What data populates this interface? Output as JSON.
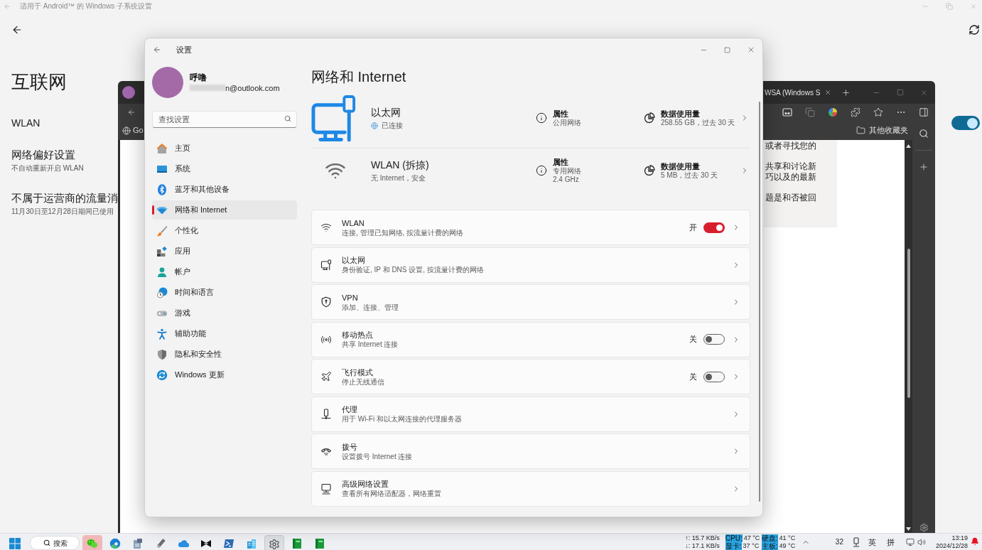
{
  "background_window": {
    "title": "适用于 Android™ 的 Windows 子系统设置",
    "heading": "互联网",
    "items": [
      {
        "kind": "toggle",
        "title": "WLAN",
        "on": true
      },
      {
        "kind": "text",
        "title": "网络偏好设置",
        "subtitle": "不自动重新开启 WLAN"
      },
      {
        "kind": "text",
        "title": "不属于运营商的流量消",
        "subtitle": "11月30日至12月28日期间已使用"
      }
    ]
  },
  "browser": {
    "tab_title": "WSA (Windows S",
    "favorites": [
      {
        "label": "Go"
      }
    ],
    "other_favorites": "其他收藏夹",
    "page_paragraphs": [
      [
        "或者寻找您的"
      ],
      [
        "共享和讨论新",
        "巧以及的最新"
      ],
      [
        "题是和否被回"
      ]
    ]
  },
  "settings": {
    "title": "设置",
    "account": {
      "name": "呼噜",
      "email": "n@outlook.com"
    },
    "search": {
      "placeholder": "查找设置"
    },
    "nav": [
      {
        "kind": "home",
        "label": "主页",
        "selected": false
      },
      {
        "kind": "system",
        "label": "系统",
        "selected": false
      },
      {
        "kind": "bluetooth",
        "label": "蓝牙和其他设备",
        "selected": false
      },
      {
        "kind": "network",
        "label": "网络和 Internet",
        "selected": true
      },
      {
        "kind": "personalization",
        "label": "个性化",
        "selected": false
      },
      {
        "kind": "apps",
        "label": "应用",
        "selected": false
      },
      {
        "kind": "accounts",
        "label": "帐户",
        "selected": false
      },
      {
        "kind": "time",
        "label": "时间和语言",
        "selected": false
      },
      {
        "kind": "gaming",
        "label": "游戏",
        "selected": false
      },
      {
        "kind": "accessibility",
        "label": "辅助功能",
        "selected": false
      },
      {
        "kind": "privacy",
        "label": "隐私和安全性",
        "selected": false
      },
      {
        "kind": "update",
        "label": "Windows 更新",
        "selected": false
      }
    ],
    "page_title": "网络和 Internet",
    "connections": [
      {
        "kind": "ethernet",
        "name": "以太网",
        "status": "已连接",
        "properties_label": "属性",
        "properties": [
          "公用网络"
        ],
        "usage_label": "数据使用量",
        "usage": "258.55 GB，过去 30 天"
      },
      {
        "kind": "wifi",
        "name": "WLAN (拆捺)",
        "status": "无 Internet，安全",
        "properties_label": "属性",
        "properties": [
          "专用网络",
          "2.4 GHz"
        ],
        "usage_label": "数据使用量",
        "usage": "5 MB，过去 30 天"
      }
    ],
    "options": [
      {
        "kind": "wifi",
        "title": "WLAN",
        "subtitle": "连接, 管理已知网络, 按流量计费的网络",
        "toggle": {
          "label": "开",
          "on": true
        }
      },
      {
        "kind": "ethernet",
        "title": "以太网",
        "subtitle": "身份验证, IP 和 DNS 设置, 按流量计费的网络"
      },
      {
        "kind": "vpn",
        "title": "VPN",
        "subtitle": "添加、连接、管理"
      },
      {
        "kind": "hotspot",
        "title": "移动热点",
        "subtitle": "共享 Internet 连接",
        "toggle": {
          "label": "关",
          "on": false
        }
      },
      {
        "kind": "airplane",
        "title": "飞行模式",
        "subtitle": "停止无线通信",
        "toggle": {
          "label": "关",
          "on": false
        }
      },
      {
        "kind": "proxy",
        "title": "代理",
        "subtitle": "用于 Wi-Fi 和以太网连接的代理服务器"
      },
      {
        "kind": "dialup",
        "title": "拨号",
        "subtitle": "设置拨号 Internet 连接"
      },
      {
        "kind": "advanced",
        "title": "高级网络设置",
        "subtitle": "查看所有网络适配器，网络重置"
      }
    ]
  },
  "taskbar": {
    "search_label": "搜索",
    "apps": [
      {
        "kind": "chat",
        "selected": false,
        "flashing": true
      },
      {
        "kind": "browser",
        "selected": false,
        "flashing": false
      },
      {
        "kind": "tool",
        "selected": false,
        "flashing": false
      },
      {
        "kind": "usb",
        "selected": false,
        "flashing": false
      },
      {
        "kind": "cloud",
        "selected": false,
        "flashing": false
      },
      {
        "kind": "editor",
        "selected": false,
        "flashing": false
      },
      {
        "kind": "terminal",
        "selected": false,
        "flashing": false
      },
      {
        "kind": "buildings",
        "selected": false,
        "flashing": false
      },
      {
        "kind": "settings",
        "selected": true,
        "flashing": false
      },
      {
        "kind": "book",
        "selected": false,
        "flashing": false
      },
      {
        "kind": "book",
        "selected": false,
        "flashing": false
      }
    ],
    "net_speed": [
      "↑: 15.7 KB/s",
      "↓: 17.1 KB/s"
    ],
    "sensors": [
      {
        "label": "CPU:",
        "value": "47 °C"
      },
      {
        "label": "硬盘:",
        "value": "41 °C"
      },
      {
        "label": "显卡:",
        "value": "37 °C"
      },
      {
        "label": "主板:",
        "value": "49 °C"
      }
    ],
    "tray_number": "32",
    "ime": [
      "英",
      "拼"
    ],
    "time": "13:19",
    "date": "2024/12/28"
  }
}
